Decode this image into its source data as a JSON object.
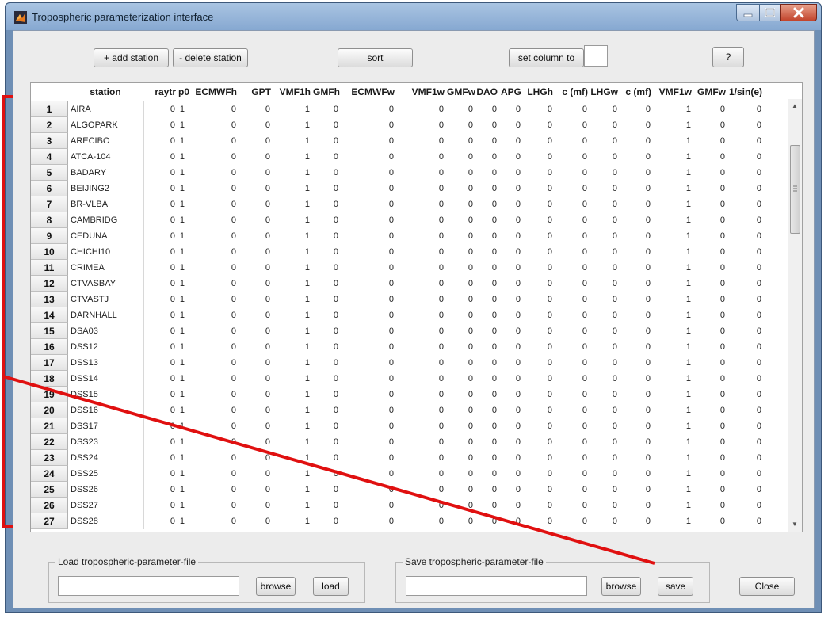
{
  "window": {
    "title": "Tropospheric parameterization interface"
  },
  "toolbar": {
    "add_station": "+ add station",
    "delete_station": "- delete station",
    "sort": "sort",
    "set_column": "set column to",
    "set_column_value": "",
    "help": "?"
  },
  "table": {
    "columns": [
      "station",
      "raytr",
      "p0",
      "ECMWFh",
      "GPT",
      "VMF1h",
      "GMFh",
      "ECMWFw",
      "VMF1w",
      "GMFw",
      "DAO",
      "APG",
      "LHGh",
      "c (mf)",
      "LHGw",
      "c (mf)",
      "VMF1w",
      "GMFw",
      "1/sin(e)"
    ],
    "rows": [
      [
        "1",
        "AIRA",
        "0",
        "1",
        "0",
        "0",
        "1",
        "0",
        "0",
        "0",
        "0",
        "0",
        "0",
        "0",
        "0",
        "0",
        "0",
        "1",
        "0",
        "0"
      ],
      [
        "2",
        "ALGOPARK",
        "0",
        "1",
        "0",
        "0",
        "1",
        "0",
        "0",
        "0",
        "0",
        "0",
        "0",
        "0",
        "0",
        "0",
        "0",
        "1",
        "0",
        "0"
      ],
      [
        "3",
        "ARECIBO",
        "0",
        "1",
        "0",
        "0",
        "1",
        "0",
        "0",
        "0",
        "0",
        "0",
        "0",
        "0",
        "0",
        "0",
        "0",
        "1",
        "0",
        "0"
      ],
      [
        "4",
        "ATCA-104",
        "0",
        "1",
        "0",
        "0",
        "1",
        "0",
        "0",
        "0",
        "0",
        "0",
        "0",
        "0",
        "0",
        "0",
        "0",
        "1",
        "0",
        "0"
      ],
      [
        "5",
        "BADARY",
        "0",
        "1",
        "0",
        "0",
        "1",
        "0",
        "0",
        "0",
        "0",
        "0",
        "0",
        "0",
        "0",
        "0",
        "0",
        "1",
        "0",
        "0"
      ],
      [
        "6",
        "BEIJING2",
        "0",
        "1",
        "0",
        "0",
        "1",
        "0",
        "0",
        "0",
        "0",
        "0",
        "0",
        "0",
        "0",
        "0",
        "0",
        "1",
        "0",
        "0"
      ],
      [
        "7",
        "BR-VLBA",
        "0",
        "1",
        "0",
        "0",
        "1",
        "0",
        "0",
        "0",
        "0",
        "0",
        "0",
        "0",
        "0",
        "0",
        "0",
        "1",
        "0",
        "0"
      ],
      [
        "8",
        "CAMBRIDG",
        "0",
        "1",
        "0",
        "0",
        "1",
        "0",
        "0",
        "0",
        "0",
        "0",
        "0",
        "0",
        "0",
        "0",
        "0",
        "1",
        "0",
        "0"
      ],
      [
        "9",
        "CEDUNA",
        "0",
        "1",
        "0",
        "0",
        "1",
        "0",
        "0",
        "0",
        "0",
        "0",
        "0",
        "0",
        "0",
        "0",
        "0",
        "1",
        "0",
        "0"
      ],
      [
        "10",
        "CHICHI10",
        "0",
        "1",
        "0",
        "0",
        "1",
        "0",
        "0",
        "0",
        "0",
        "0",
        "0",
        "0",
        "0",
        "0",
        "0",
        "1",
        "0",
        "0"
      ],
      [
        "11",
        "CRIMEA",
        "0",
        "1",
        "0",
        "0",
        "1",
        "0",
        "0",
        "0",
        "0",
        "0",
        "0",
        "0",
        "0",
        "0",
        "0",
        "1",
        "0",
        "0"
      ],
      [
        "12",
        "CTVASBAY",
        "0",
        "1",
        "0",
        "0",
        "1",
        "0",
        "0",
        "0",
        "0",
        "0",
        "0",
        "0",
        "0",
        "0",
        "0",
        "1",
        "0",
        "0"
      ],
      [
        "13",
        "CTVASTJ",
        "0",
        "1",
        "0",
        "0",
        "1",
        "0",
        "0",
        "0",
        "0",
        "0",
        "0",
        "0",
        "0",
        "0",
        "0",
        "1",
        "0",
        "0"
      ],
      [
        "14",
        "DARNHALL",
        "0",
        "1",
        "0",
        "0",
        "1",
        "0",
        "0",
        "0",
        "0",
        "0",
        "0",
        "0",
        "0",
        "0",
        "0",
        "1",
        "0",
        "0"
      ],
      [
        "15",
        "DSA03",
        "0",
        "1",
        "0",
        "0",
        "1",
        "0",
        "0",
        "0",
        "0",
        "0",
        "0",
        "0",
        "0",
        "0",
        "0",
        "1",
        "0",
        "0"
      ],
      [
        "16",
        "DSS12",
        "0",
        "1",
        "0",
        "0",
        "1",
        "0",
        "0",
        "0",
        "0",
        "0",
        "0",
        "0",
        "0",
        "0",
        "0",
        "1",
        "0",
        "0"
      ],
      [
        "17",
        "DSS13",
        "0",
        "1",
        "0",
        "0",
        "1",
        "0",
        "0",
        "0",
        "0",
        "0",
        "0",
        "0",
        "0",
        "0",
        "0",
        "1",
        "0",
        "0"
      ],
      [
        "18",
        "DSS14",
        "0",
        "1",
        "0",
        "0",
        "1",
        "0",
        "0",
        "0",
        "0",
        "0",
        "0",
        "0",
        "0",
        "0",
        "0",
        "1",
        "0",
        "0"
      ],
      [
        "19",
        "DSS15",
        "0",
        "1",
        "0",
        "0",
        "1",
        "0",
        "0",
        "0",
        "0",
        "0",
        "0",
        "0",
        "0",
        "0",
        "0",
        "1",
        "0",
        "0"
      ],
      [
        "20",
        "DSS16",
        "0",
        "1",
        "0",
        "0",
        "1",
        "0",
        "0",
        "0",
        "0",
        "0",
        "0",
        "0",
        "0",
        "0",
        "0",
        "1",
        "0",
        "0"
      ],
      [
        "21",
        "DSS17",
        "0",
        "1",
        "0",
        "0",
        "1",
        "0",
        "0",
        "0",
        "0",
        "0",
        "0",
        "0",
        "0",
        "0",
        "0",
        "1",
        "0",
        "0"
      ],
      [
        "22",
        "DSS23",
        "0",
        "1",
        "0",
        "0",
        "1",
        "0",
        "0",
        "0",
        "0",
        "0",
        "0",
        "0",
        "0",
        "0",
        "0",
        "1",
        "0",
        "0"
      ],
      [
        "23",
        "DSS24",
        "0",
        "1",
        "0",
        "0",
        "1",
        "0",
        "0",
        "0",
        "0",
        "0",
        "0",
        "0",
        "0",
        "0",
        "0",
        "1",
        "0",
        "0"
      ],
      [
        "24",
        "DSS25",
        "0",
        "1",
        "0",
        "0",
        "1",
        "0",
        "0",
        "0",
        "0",
        "0",
        "0",
        "0",
        "0",
        "0",
        "0",
        "1",
        "0",
        "0"
      ],
      [
        "25",
        "DSS26",
        "0",
        "1",
        "0",
        "0",
        "1",
        "0",
        "0",
        "0",
        "0",
        "0",
        "0",
        "0",
        "0",
        "0",
        "0",
        "1",
        "0",
        "0"
      ],
      [
        "26",
        "DSS27",
        "0",
        "1",
        "0",
        "0",
        "1",
        "0",
        "0",
        "0",
        "0",
        "0",
        "0",
        "0",
        "0",
        "0",
        "0",
        "1",
        "0",
        "0"
      ],
      [
        "27",
        "DSS28",
        "0",
        "1",
        "0",
        "0",
        "1",
        "0",
        "0",
        "0",
        "0",
        "0",
        "0",
        "0",
        "0",
        "0",
        "0",
        "1",
        "0",
        "0"
      ]
    ]
  },
  "load_group": {
    "title": "Load tropospheric-parameter-file",
    "path": "",
    "browse": "browse",
    "action": "load"
  },
  "save_group": {
    "title": "Save tropospheric-parameter-file",
    "path": "",
    "browse": "browse",
    "action": "save"
  },
  "close": "Close",
  "icons": {
    "app": "matlab-icon",
    "minimize": "minimize-icon",
    "maximize": "maximize-icon",
    "close": "close-icon"
  },
  "annotation": {
    "color": "#e01010"
  }
}
